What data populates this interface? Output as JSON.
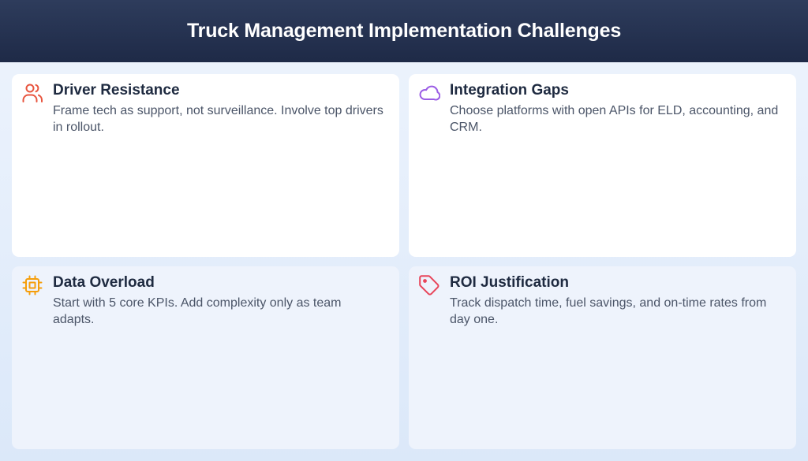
{
  "header": {
    "title": "Truck Management Implementation Challenges"
  },
  "cards": [
    {
      "icon": "users-icon",
      "icon_color": "#e8553f",
      "title": "Driver Resistance",
      "text": "Frame tech as support, not surveillance. Involve top drivers in rollout."
    },
    {
      "icon": "cloud-icon",
      "icon_color": "#9b5de5",
      "title": "Integration Gaps",
      "text": "Choose platforms with open APIs for ELD, accounting, and CRM."
    },
    {
      "icon": "cpu-chip-icon",
      "icon_color": "#f59e0b",
      "title": "Data Overload",
      "text": "Start with 5 core KPIs. Add complexity only as team adapts."
    },
    {
      "icon": "tag-icon",
      "icon_color": "#e8455a",
      "title": "ROI Justification",
      "text": "Track dispatch time, fuel savings, and on-time rates from day one."
    }
  ]
}
